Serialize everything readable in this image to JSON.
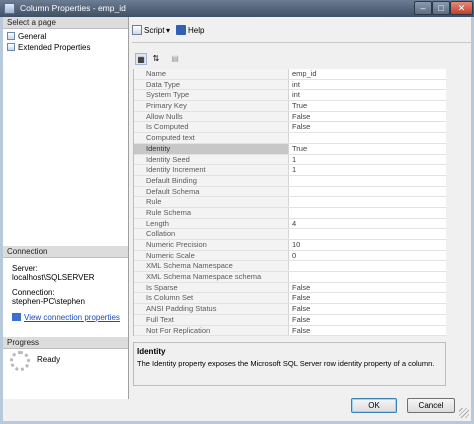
{
  "window": {
    "title": "Column Properties - emp_id"
  },
  "left": {
    "select_page_header": "Select a page",
    "pages": [
      "General",
      "Extended Properties"
    ],
    "connection_header": "Connection",
    "server_label": "Server:",
    "server_value": "localhost\\SQLSERVER",
    "connection_label": "Connection:",
    "connection_value": "stephen-PC\\stephen",
    "view_link": "View connection properties",
    "progress_header": "Progress",
    "progress_status": "Ready"
  },
  "toolbar": {
    "script_label": "Script",
    "help_label": "Help"
  },
  "properties": [
    {
      "name": "Name",
      "value": "emp_id"
    },
    {
      "name": "Data Type",
      "value": "int"
    },
    {
      "name": "System Type",
      "value": "int"
    },
    {
      "name": "Primary Key",
      "value": "True"
    },
    {
      "name": "Allow Nulls",
      "value": "False"
    },
    {
      "name": "Is Computed",
      "value": "False"
    },
    {
      "name": "Computed text",
      "value": ""
    },
    {
      "name": "Identity",
      "value": "True"
    },
    {
      "name": "Identity Seed",
      "value": "1"
    },
    {
      "name": "Identity Increment",
      "value": "1"
    },
    {
      "name": "Default Binding",
      "value": ""
    },
    {
      "name": "Default Schema",
      "value": ""
    },
    {
      "name": "Rule",
      "value": ""
    },
    {
      "name": "Rule Schema",
      "value": ""
    },
    {
      "name": "Length",
      "value": "4"
    },
    {
      "name": "Collation",
      "value": ""
    },
    {
      "name": "Numeric Precision",
      "value": "10"
    },
    {
      "name": "Numeric Scale",
      "value": "0"
    },
    {
      "name": "XML Schema Namespace",
      "value": ""
    },
    {
      "name": "XML Schema Namespace schema",
      "value": ""
    },
    {
      "name": "Is Sparse",
      "value": "False"
    },
    {
      "name": "Is Column Set",
      "value": "False"
    },
    {
      "name": "ANSI Padding Status",
      "value": "False"
    },
    {
      "name": "Full Text",
      "value": "False"
    },
    {
      "name": "Not For Replication",
      "value": "False"
    }
  ],
  "selected_property": "Identity",
  "description": {
    "title": "Identity",
    "text": "The Identity property exposes the Microsoft SQL Server row identity property of a column."
  },
  "buttons": {
    "ok": "OK",
    "cancel": "Cancel"
  },
  "icons": [
    "sort-categorized-icon",
    "sort-alphabetical-icon",
    "property-pages-icon",
    "script-icon",
    "help-icon",
    "page-icon",
    "connection-properties-icon",
    "progress-spinner-icon"
  ]
}
